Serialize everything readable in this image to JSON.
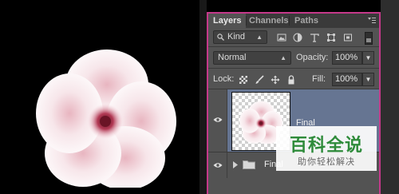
{
  "layers_panel": {
    "tabs": [
      {
        "label": "Layers",
        "active": true
      },
      {
        "label": "Channels",
        "active": false
      },
      {
        "label": "Paths",
        "active": false
      }
    ],
    "filter": {
      "label": "Kind"
    },
    "blend_mode": {
      "value": "Normal"
    },
    "opacity": {
      "label": "Opacity:",
      "value": "100%"
    },
    "lock": {
      "label": "Lock:"
    },
    "fill": {
      "label": "Fill:",
      "value": "100%"
    },
    "layers": [
      {
        "name": "Final",
        "selected": true,
        "visible": true
      },
      {
        "name": "Final",
        "type": "group",
        "visible": true
      }
    ]
  },
  "watermark": {
    "title": "百科全说",
    "subtitle": "助你轻松解决"
  },
  "colors": {
    "panel_bg": "#535353",
    "selected_layer": "#667592",
    "accent_border": "#c4398a",
    "canvas_bg": "#000000"
  }
}
